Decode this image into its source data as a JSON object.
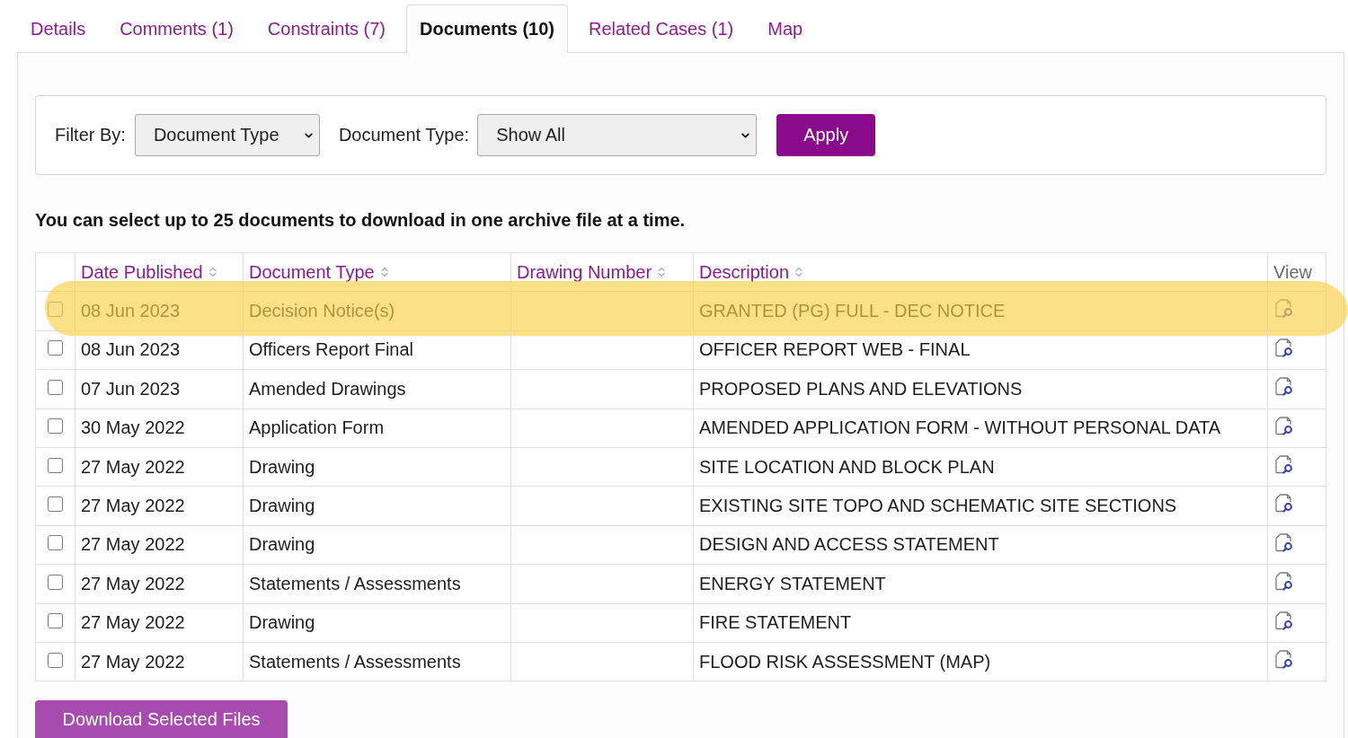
{
  "tabs": [
    {
      "label": "Details",
      "selected": false
    },
    {
      "label": "Comments (1)",
      "selected": false
    },
    {
      "label": "Constraints (7)",
      "selected": false
    },
    {
      "label": "Documents (10)",
      "selected": true
    },
    {
      "label": "Related Cases (1)",
      "selected": false
    },
    {
      "label": "Map",
      "selected": false
    }
  ],
  "filter": {
    "filter_by_label": "Filter By:",
    "filter_by_value": "Document Type",
    "document_type_label": "Document Type:",
    "document_type_value": "Show All",
    "apply_button": "Apply"
  },
  "notice": "You can select up to 25 documents to download in one archive file at a time.",
  "table": {
    "columns": [
      {
        "label": "Date Published",
        "sortable": true
      },
      {
        "label": "Document Type",
        "sortable": true
      },
      {
        "label": "Drawing Number",
        "sortable": true
      },
      {
        "label": "Description",
        "sortable": true
      },
      {
        "label": "View",
        "sortable": false
      }
    ],
    "rows": [
      {
        "checked": false,
        "highlighted": true,
        "date_published": "08 Jun 2023",
        "document_type": "Decision Notice(s)",
        "description": "GRANTED (PG) FULL - DEC NOTICE"
      },
      {
        "checked": false,
        "highlighted": false,
        "date_published": "08 Jun 2023",
        "document_type": "Officers Report Final",
        "description": "OFFICER REPORT WEB - FINAL"
      },
      {
        "checked": false,
        "highlighted": false,
        "date_published": "07 Jun 2023",
        "document_type": "Amended Drawings",
        "description": "PROPOSED PLANS AND ELEVATIONS"
      },
      {
        "checked": false,
        "highlighted": false,
        "date_published": "30 May 2022",
        "document_type": "Application Form",
        "description": "AMENDED APPLICATION FORM - WITHOUT PERSONAL DATA"
      },
      {
        "checked": false,
        "highlighted": false,
        "date_published": "27 May 2022",
        "document_type": "Drawing",
        "description": "SITE LOCATION AND BLOCK PLAN"
      },
      {
        "checked": false,
        "highlighted": false,
        "date_published": "27 May 2022",
        "document_type": "Drawing",
        "description": "EXISTING SITE TOPO AND SCHEMATIC SITE SECTIONS"
      },
      {
        "checked": false,
        "highlighted": false,
        "date_published": "27 May 2022",
        "document_type": "Drawing",
        "description": "DESIGN AND ACCESS STATEMENT"
      },
      {
        "checked": false,
        "highlighted": false,
        "date_published": "27 May 2022",
        "document_type": "Statements / Assessments",
        "description": "ENERGY STATEMENT"
      },
      {
        "checked": false,
        "highlighted": false,
        "date_published": "27 May 2022",
        "document_type": "Drawing",
        "description": "FIRE STATEMENT"
      },
      {
        "checked": false,
        "highlighted": false,
        "date_published": "27 May 2022",
        "document_type": "Statements / Assessments",
        "description": "FLOOD RISK ASSESSMENT (MAP)"
      }
    ]
  },
  "download_button": "Download Selected Files"
}
